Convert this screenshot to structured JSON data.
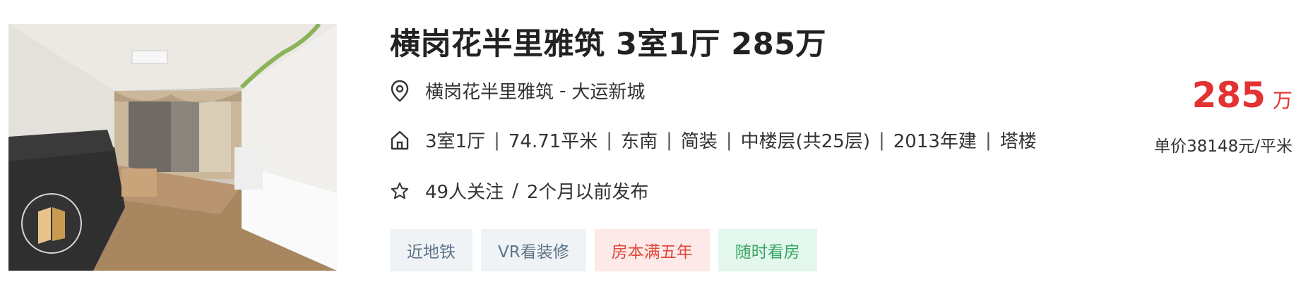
{
  "listing": {
    "title": "横岗花半里雅筑 3室1厅 285万",
    "location": {
      "community": "横岗花半里雅筑",
      "separator": "-",
      "district": "大运新城"
    },
    "info": [
      "3室1厅",
      "74.71平米",
      "东南",
      "简装",
      "中楼层(共25层)",
      "2013年建",
      "塔楼"
    ],
    "info_separator": "|",
    "follow": {
      "followers": "49人关注",
      "slash": "/",
      "published": "2个月以前发布"
    },
    "tags": [
      "近地铁",
      "VR看装修",
      "房本满五年",
      "随时看房"
    ],
    "price": {
      "total": "285",
      "unit": "万",
      "unit_price": "单价38148元/平米"
    }
  },
  "icons": {
    "location": "location-pin-icon",
    "house": "house-icon",
    "star": "star-icon",
    "vr": "vr-icon"
  },
  "colors": {
    "price": "#e33232",
    "tag_gray_text": "#5e7488",
    "tag_red_text": "#e2483b",
    "tag_green_text": "#3aa565"
  }
}
